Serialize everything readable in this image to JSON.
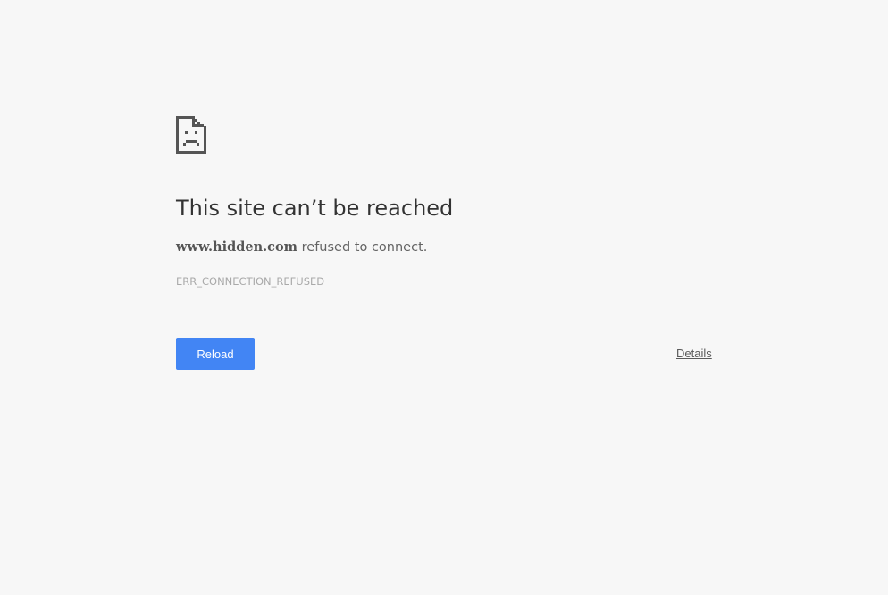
{
  "error_page": {
    "icon": "sad-page-icon",
    "title": "This site can’t be reached",
    "host": "www.hidden.com",
    "summary_suffix": " refused to connect.",
    "error_code": "ERR_CONNECTION_REFUSED",
    "reload_label": "Reload",
    "details_label": "Details"
  },
  "colors": {
    "background": "#f7f7f7",
    "button": "#4285f4",
    "title_text": "#333333",
    "error_code_text": "#a9a9a9"
  }
}
